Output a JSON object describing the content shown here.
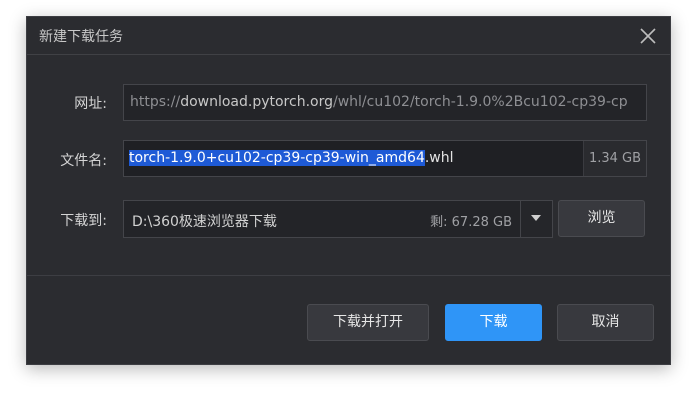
{
  "dialog": {
    "title": "新建下载任务"
  },
  "url": {
    "label": "网址:",
    "prefix": "https://",
    "host": "download.pytorch.org",
    "path": "/whl/cu102/torch-1.9.0%2Bcu102-cp39-cp"
  },
  "filename": {
    "label": "文件名:",
    "selected": "torch-1.9.0+cu102-cp39-cp39-win_amd64",
    "extension": ".whl",
    "size": "1.34 GB"
  },
  "destination": {
    "label": "下载到:",
    "path": "D:\\360极速浏览器下载",
    "free_space": "剩: 67.28 GB",
    "browse_label": "浏览"
  },
  "actions": {
    "download_open_label": "下载并打开",
    "download_label": "下载",
    "cancel_label": "取消"
  },
  "colors": {
    "primary": "#2f95f7",
    "selection": "#1e5ad6",
    "background": "#2b2c30"
  },
  "icons": {
    "close": "close-icon",
    "dropdown": "caret-down-icon"
  }
}
